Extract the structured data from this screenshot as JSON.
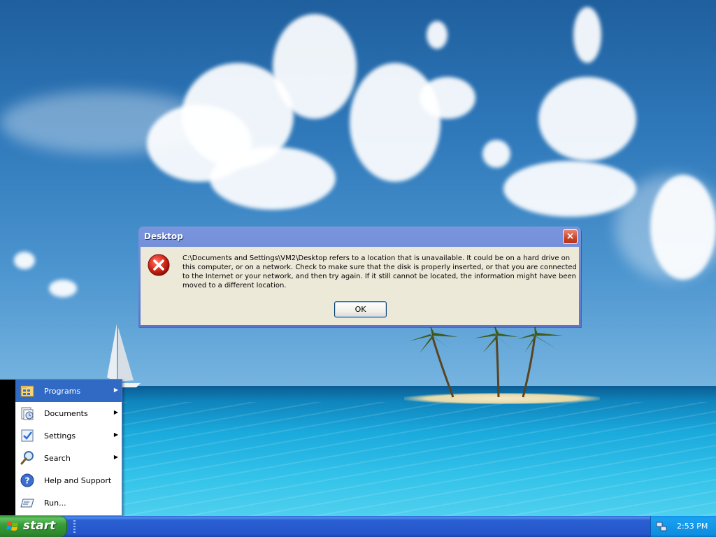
{
  "dialog": {
    "title": "Desktop",
    "close_label": "×",
    "message": "C:\\Documents and Settings\\VM2\\Desktop refers to a location that is unavailable. It could be on a hard drive on this computer, or on a network. Check to make sure that the disk is properly inserted, or that you are connected to the Internet or your network, and then try again. If it still cannot be located, the information might have been moved to a different location.",
    "ok_label": "OK"
  },
  "start_menu": {
    "items": [
      {
        "label": "Programs",
        "icon": "programs-icon",
        "has_submenu": true,
        "active": true
      },
      {
        "label": "Documents",
        "icon": "documents-icon",
        "has_submenu": true
      },
      {
        "label": "Settings",
        "icon": "settings-icon",
        "has_submenu": true
      },
      {
        "label": "Search",
        "icon": "search-icon",
        "has_submenu": true
      },
      {
        "label": "Help and Support",
        "icon": "help-icon",
        "has_submenu": false
      },
      {
        "label": "Run...",
        "icon": "run-icon",
        "has_submenu": false
      }
    ]
  },
  "taskbar": {
    "start_label": "start",
    "clock": "2:53 PM"
  },
  "colors": {
    "dialog_title": "#5b76c9",
    "dialog_body": "#ece9d8",
    "menu_highlight": "#316ac5",
    "taskbar": "#2456cc",
    "start_button": "#3a9c3a",
    "tray": "#0d8de0"
  }
}
